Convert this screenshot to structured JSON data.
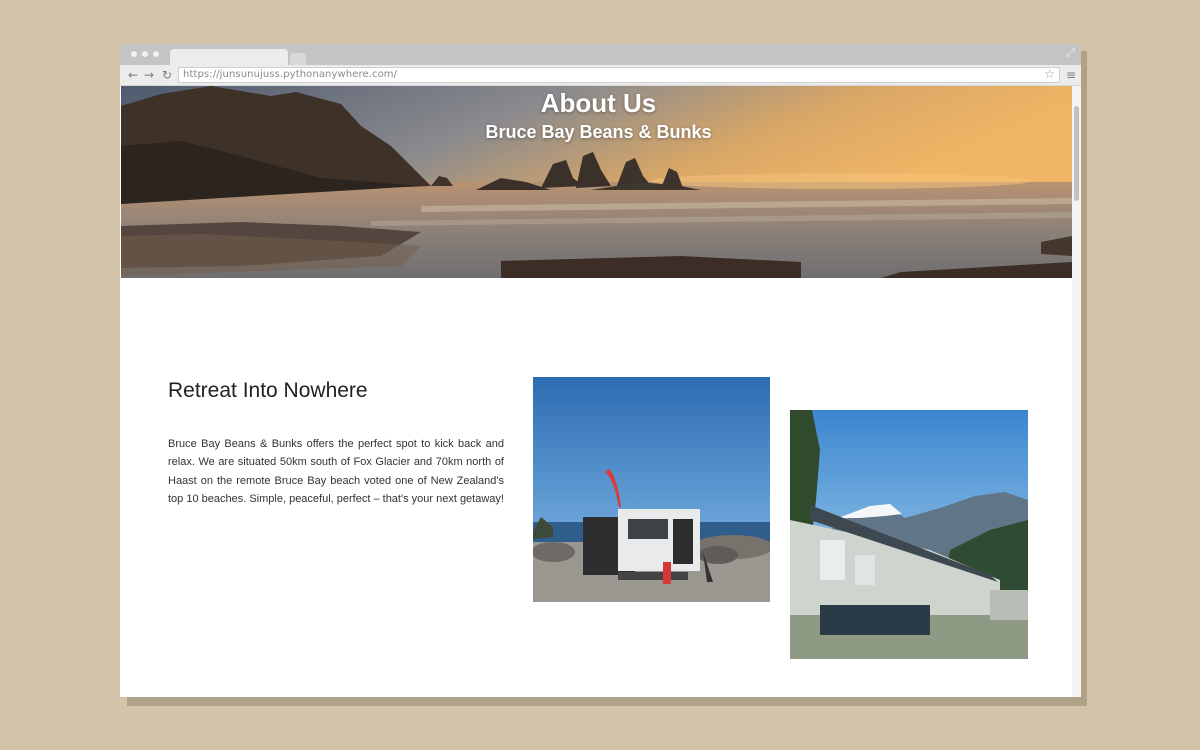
{
  "browser": {
    "url": "https://junsunujuss.pythonanywhere.com/",
    "icons": [
      "back-arrow-icon",
      "forward-arrow-icon",
      "reload-icon",
      "star-icon",
      "menu-icon",
      "expand-icon"
    ]
  },
  "hero": {
    "title": "About Us",
    "subtitle": "Bruce Bay Beans & Bunks"
  },
  "about": {
    "heading": "Retreat Into Nowhere",
    "text": "Bruce Bay Beans & Bunks offers the perfect spot to kick back and relax. We are situated 50km south of Fox Glacier and 70km north of Haast on the remote Bruce Bay beach voted one of New Zealand's top 10 beaches. Simple, peaceful, perfect – that's your next getaway!"
  },
  "colors": {
    "page_background": "#d3c3a9",
    "heading_text": "#222222",
    "body_text": "#333333"
  }
}
